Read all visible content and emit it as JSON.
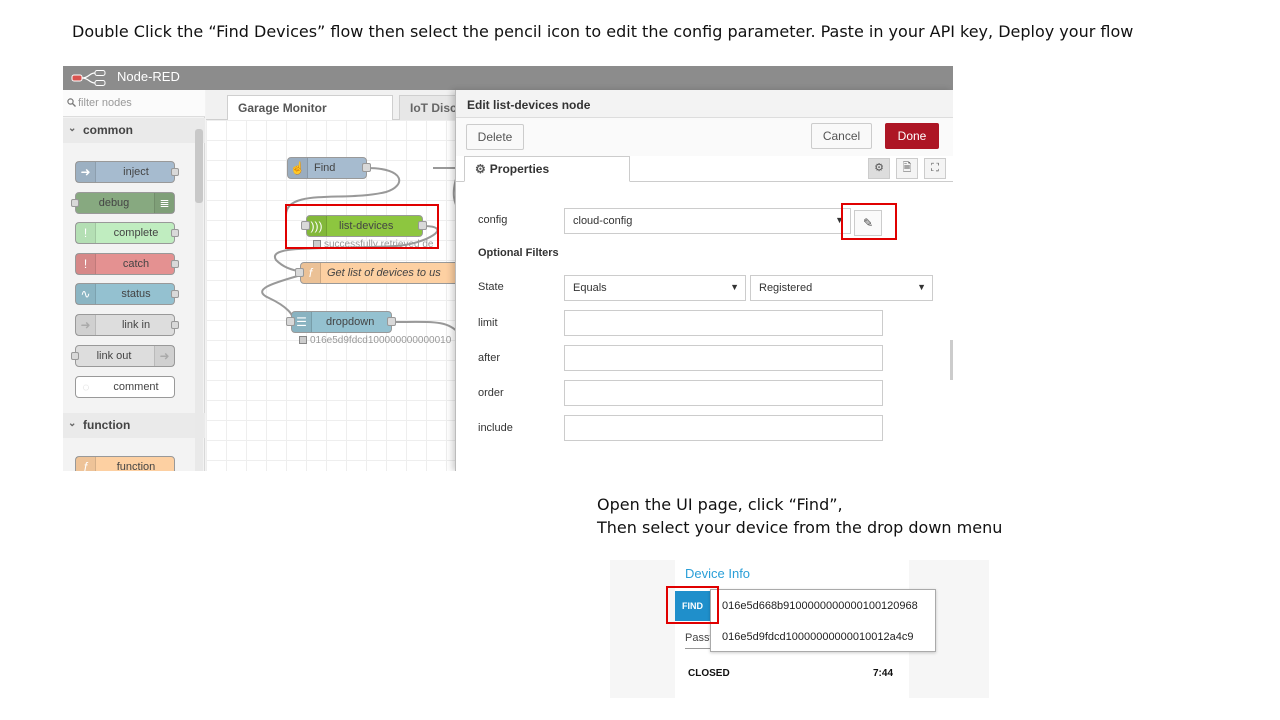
{
  "instructions": {
    "top": "Double Click the “Find Devices” flow then select the pencil icon to edit the config parameter. Paste in your API key, Deploy your flow",
    "bottom_line1": "Open the UI page, click “Find”,",
    "bottom_line2": "Then select your device from the drop down menu"
  },
  "nodered": {
    "app_title": "Node-RED",
    "palette": {
      "search_placeholder": "filter nodes",
      "categories": [
        "common",
        "function"
      ],
      "nodes": [
        {
          "label": "inject",
          "color": "#a6bbcf"
        },
        {
          "label": "debug",
          "color": "#87a980"
        },
        {
          "label": "complete",
          "color": "#c0edc0"
        },
        {
          "label": "catch",
          "color": "#e49191"
        },
        {
          "label": "status",
          "color": "#94c1d0"
        },
        {
          "label": "link in",
          "color": "#dddddd"
        },
        {
          "label": "link out",
          "color": "#dddddd"
        },
        {
          "label": "comment",
          "color": "#ffffff"
        },
        {
          "label": "function",
          "color": "#fdd0a2"
        }
      ]
    },
    "workspace": {
      "tabs": [
        "Garage Monitor",
        "IoT Disco"
      ],
      "flow_nodes": {
        "find": "Find",
        "list_devices": "list-devices",
        "list_devices_status": "successfully retrieved de",
        "function_label": "Get list of devices to us",
        "dropdown": "dropdown",
        "dropdown_status": "016e5d9fdcd100000000000010"
      }
    },
    "tray": {
      "title": "Edit list-devices node",
      "delete": "Delete",
      "cancel": "Cancel",
      "done": "Done",
      "properties_tab": "Properties",
      "config_label": "config",
      "config_value": "cloud-config",
      "optional_filters": "Optional Filters",
      "state_label": "State",
      "state_operator": "Equals",
      "state_value": "Registered",
      "limit_label": "limit",
      "after_label": "after",
      "order_label": "order",
      "include_label": "include"
    },
    "colors": {
      "header": "#8c8c8c",
      "done_button": "#ad1625",
      "list_devices_node": "#8dc63f",
      "highlight": "#e00000"
    }
  },
  "dashboard": {
    "title": "Device Info",
    "find_button": "FIND",
    "password_label": "Passv",
    "device_options": [
      "016e5d668b9100000000000100120968",
      "016e5d9fdcd10000000000010012a4c9"
    ],
    "door_status": "CLOSED",
    "time": "7:44"
  }
}
